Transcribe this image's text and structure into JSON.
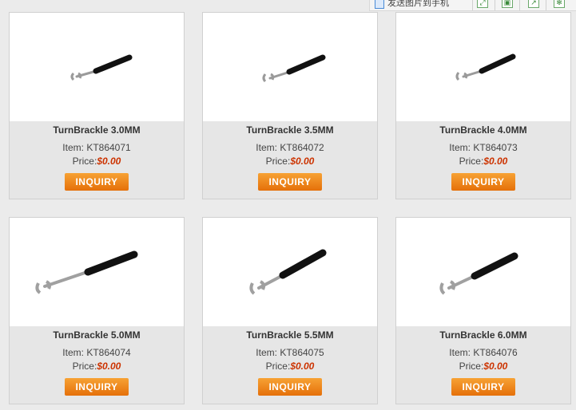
{
  "toolbar": {
    "send_label": "发送图片到手机",
    "icons": [
      "expand-icon",
      "save-icon",
      "share-icon",
      "settings-icon"
    ]
  },
  "products": [
    {
      "name": "TurnBrackle 3.0MM",
      "item_label": "Item:",
      "item_code": "KT864071",
      "price_label": "Price:",
      "price": "$0.00",
      "button": "INQUIRY"
    },
    {
      "name": "TurnBrackle 3.5MM",
      "item_label": "Item:",
      "item_code": "KT864072",
      "price_label": "Price:",
      "price": "$0.00",
      "button": "INQUIRY"
    },
    {
      "name": "TurnBrackle 4.0MM",
      "item_label": "Item:",
      "item_code": "KT864073",
      "price_label": "Price:",
      "price": "$0.00",
      "button": "INQUIRY"
    },
    {
      "name": "TurnBrackle 5.0MM",
      "item_label": "Item:",
      "item_code": "KT864074",
      "price_label": "Price:",
      "price": "$0.00",
      "button": "INQUIRY"
    },
    {
      "name": "TurnBrackle 5.5MM",
      "item_label": "Item:",
      "item_code": "KT864075",
      "price_label": "Price:",
      "price": "$0.00",
      "button": "INQUIRY"
    },
    {
      "name": "TurnBrackle 6.0MM",
      "item_label": "Item:",
      "item_code": "KT864076",
      "price_label": "Price:",
      "price": "$0.00",
      "button": "INQUIRY"
    }
  ],
  "colors": {
    "button": "#f08a1c",
    "price": "#cc3300",
    "background": "#ebebeb"
  }
}
